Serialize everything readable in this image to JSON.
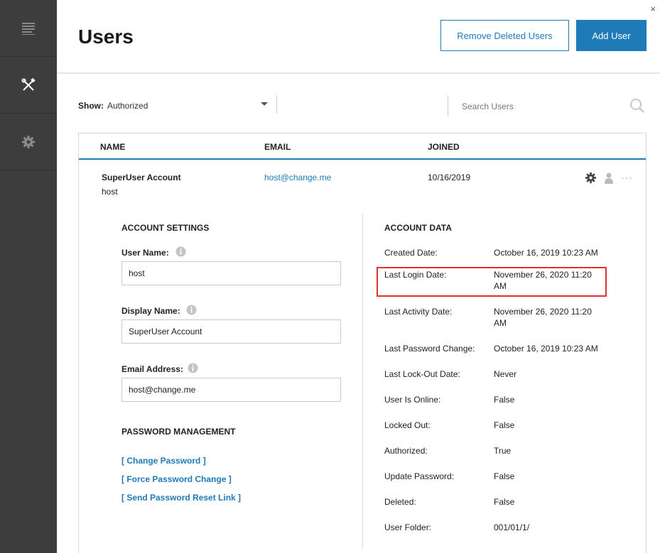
{
  "header": {
    "title": "Users",
    "close_glyph": "×",
    "remove_deleted_label": "Remove Deleted Users",
    "add_user_label": "Add User"
  },
  "sidebar": {
    "items": [
      {
        "icon": "document-lines-icon"
      },
      {
        "icon": "tools-icon"
      },
      {
        "icon": "gear-icon"
      }
    ]
  },
  "filter": {
    "show_label": "Show:",
    "show_value": "Authorized",
    "search_placeholder": "Search Users"
  },
  "table": {
    "columns": [
      "NAME",
      "EMAIL",
      "JOINED"
    ],
    "row": {
      "display_name": "SuperUser Account",
      "username": "host",
      "email": "host@change.me",
      "joined": "10/16/2019",
      "more_glyph": "···"
    }
  },
  "account_settings": {
    "title": "ACCOUNT SETTINGS",
    "username_label": "User Name:",
    "username_value": "host",
    "display_name_label": "Display Name:",
    "display_name_value": "SuperUser Account",
    "email_label": "Email Address:",
    "email_value": "host@change.me"
  },
  "password_management": {
    "title": "PASSWORD MANAGEMENT",
    "links": [
      "[ Change Password ]",
      "[ Force Password Change ]",
      "[ Send Password Reset Link ]"
    ]
  },
  "account_data": {
    "title": "ACCOUNT DATA",
    "rows": [
      {
        "label": "Created Date:",
        "value": "October 16, 2019 10:23 AM"
      },
      {
        "label": "Last Login Date:",
        "value": "November 26, 2020 11:20 AM"
      },
      {
        "label": "Last Activity Date:",
        "value": "November 26, 2020 11:20 AM"
      },
      {
        "label": "Last Password Change:",
        "value": "October 16, 2019 10:23 AM"
      },
      {
        "label": "Last Lock-Out Date:",
        "value": "Never"
      },
      {
        "label": "User Is Online:",
        "value": "False"
      },
      {
        "label": "Locked Out:",
        "value": "False"
      },
      {
        "label": "Authorized:",
        "value": "True"
      },
      {
        "label": "Update Password:",
        "value": "False"
      },
      {
        "label": "Deleted:",
        "value": "False"
      },
      {
        "label": "User Folder:",
        "value": "001/01/1/"
      }
    ]
  },
  "colors": {
    "accent": "#1e7bb8",
    "sidebar_bg": "#3d3d3d",
    "highlight": "#e0312f"
  }
}
